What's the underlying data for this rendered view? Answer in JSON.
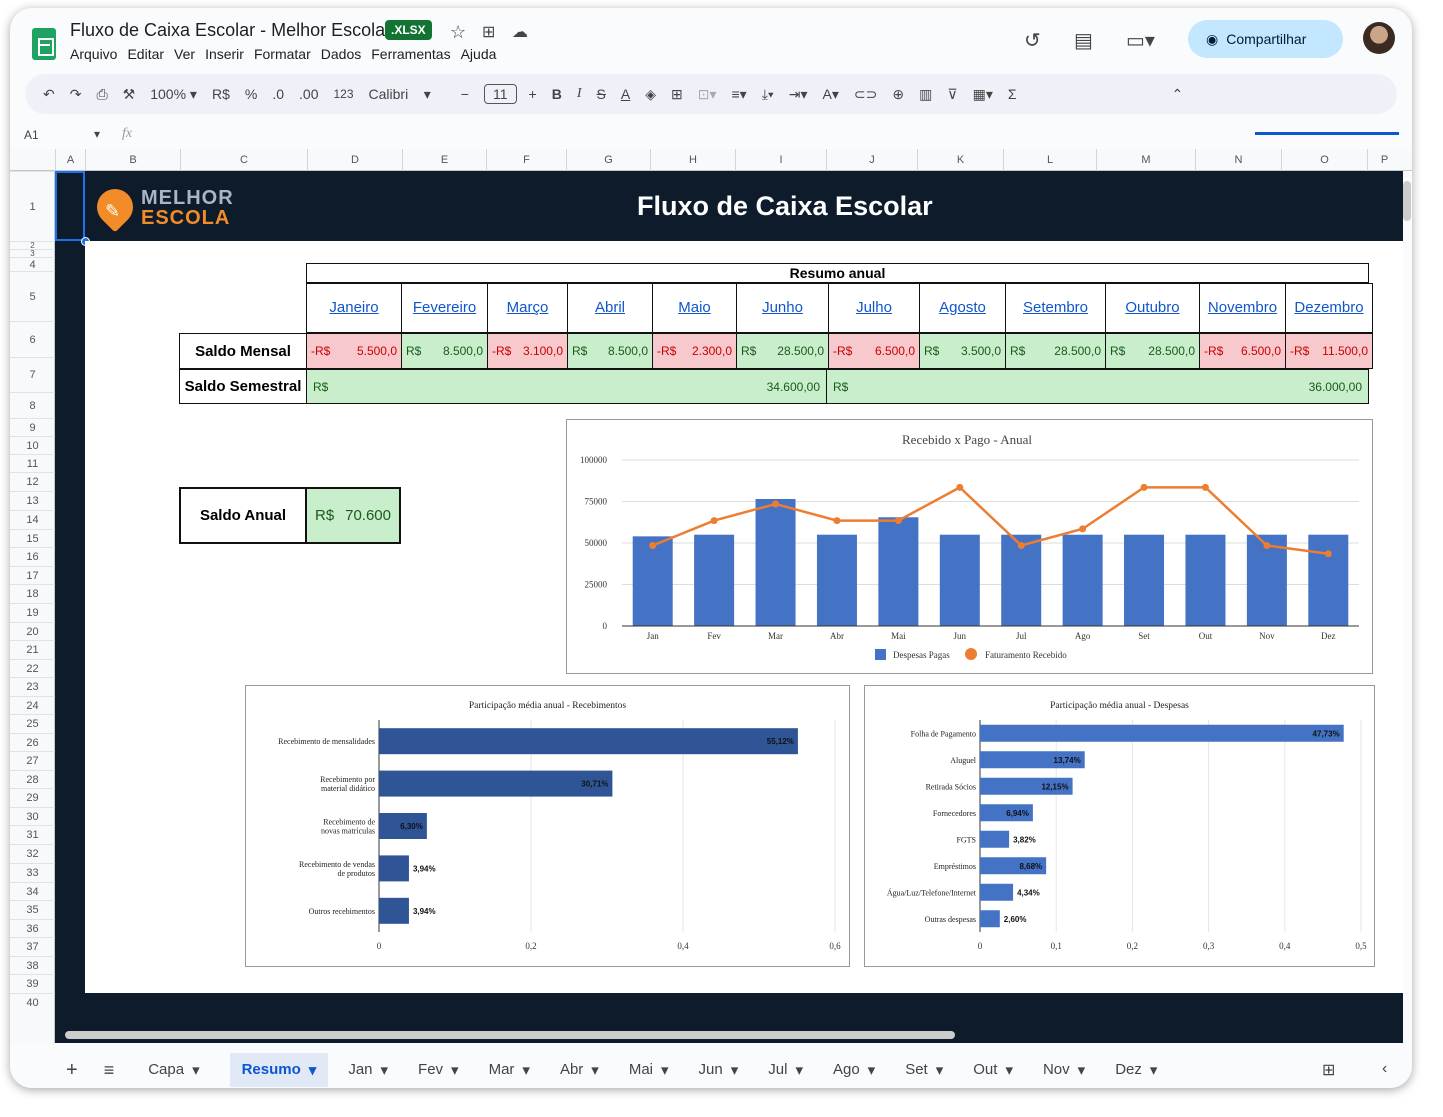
{
  "app": {
    "title": "Fluxo de Caixa Escolar - Melhor Escola",
    "badge": ".XLSX",
    "menu": [
      "Arquivo",
      "Editar",
      "Ver",
      "Inserir",
      "Formatar",
      "Dados",
      "Ferramentas",
      "Ajuda"
    ],
    "share_label": "Compartilhar"
  },
  "toolbar": {
    "zoom": "100%",
    "currency": "R$",
    "percent": "%",
    "dec_less": ".0",
    "dec_more": ".00",
    "format123": "123",
    "font": "Calibri",
    "font_size": "11"
  },
  "formula_bar": {
    "cell_ref": "A1",
    "fx": "fx"
  },
  "columns": [
    "A",
    "B",
    "C",
    "D",
    "E",
    "F",
    "G",
    "H",
    "I",
    "J",
    "K",
    "L",
    "M",
    "N",
    "O",
    "P"
  ],
  "rows": [
    "1",
    "2",
    "3",
    "4",
    "5",
    "6",
    "7",
    "8",
    "9",
    "10",
    "11",
    "12",
    "13",
    "14",
    "15",
    "16",
    "17",
    "18",
    "19",
    "20",
    "21",
    "22",
    "23",
    "24",
    "25",
    "26",
    "27",
    "28",
    "29",
    "30",
    "31",
    "32",
    "33",
    "34",
    "35",
    "36",
    "37",
    "38",
    "39",
    "40"
  ],
  "banner": {
    "brand_line1": "MELHOR",
    "brand_line2": "ESCOLA",
    "title": "Fluxo de Caixa Escolar"
  },
  "summary": {
    "header": "Resumo anual",
    "months": [
      "Janeiro",
      "Fevereiro",
      "Março",
      "Abril",
      "Maio",
      "Junho",
      "Julho",
      "Agosto",
      "Setembro",
      "Outubro",
      "Novembro",
      "Dezembro"
    ],
    "saldo_mensal_label": "Saldo Mensal",
    "saldo_mensal": [
      {
        "prefix": "-R$",
        "value": "5.500,0",
        "neg": true
      },
      {
        "prefix": "R$",
        "value": "8.500,0",
        "neg": false
      },
      {
        "prefix": "-R$",
        "value": "3.100,0",
        "neg": true
      },
      {
        "prefix": "R$",
        "value": "8.500,0",
        "neg": false
      },
      {
        "prefix": "-R$",
        "value": "2.300,0",
        "neg": true
      },
      {
        "prefix": "R$",
        "value": "28.500,0",
        "neg": false
      },
      {
        "prefix": "-R$",
        "value": "6.500,0",
        "neg": true
      },
      {
        "prefix": "R$",
        "value": "3.500,0",
        "neg": false
      },
      {
        "prefix": "R$",
        "value": "28.500,0",
        "neg": false
      },
      {
        "prefix": "R$",
        "value": "28.500,0",
        "neg": false
      },
      {
        "prefix": "-R$",
        "value": "6.500,0",
        "neg": true
      },
      {
        "prefix": "-R$",
        "value": "11.500,0",
        "neg": true
      }
    ],
    "saldo_semestral_label": "Saldo Semestral",
    "semestral": [
      {
        "prefix": "R$",
        "value": "34.600,00"
      },
      {
        "prefix": "R$",
        "value": "36.000,00"
      }
    ],
    "saldo_anual_label": "Saldo Anual",
    "saldo_anual_prefix": "R$",
    "saldo_anual_value": "70.600"
  },
  "chart_data": [
    {
      "type": "bar",
      "title": "Recebido x Pago - Anual",
      "categories": [
        "Jan",
        "Fev",
        "Mar",
        "Abr",
        "Mai",
        "Jun",
        "Jul",
        "Ago",
        "Set",
        "Out",
        "Nov",
        "Dez"
      ],
      "series": [
        {
          "name": "Despesas Pagas",
          "type": "bar",
          "color": "#4472c4",
          "values": [
            54000,
            55000,
            76500,
            55000,
            65500,
            55000,
            55000,
            55000,
            55000,
            55000,
            55000,
            55000
          ]
        },
        {
          "name": "Faturamento Recebido",
          "type": "line",
          "color": "#ed7d31",
          "values": [
            48500,
            63500,
            73500,
            63500,
            63500,
            83500,
            48500,
            58500,
            83500,
            83500,
            48500,
            43500
          ]
        }
      ],
      "yticks": [
        "0",
        "25000",
        "50000",
        "75000",
        "100000"
      ],
      "ylim": [
        0,
        100000
      ],
      "legend": "bottom"
    },
    {
      "type": "bar",
      "orientation": "horizontal",
      "title": "Participação média anual - Recebimentos",
      "categories": [
        "Recebimento de mensalidades",
        "Recebimento por material didático",
        "Recebimento de novas matrículas",
        "Recebimento de vendas de produtos",
        "Outros recebimentos"
      ],
      "values": [
        0.5512,
        0.3071,
        0.063,
        0.0394,
        0.0394
      ],
      "labels": [
        "55,12%",
        "30,71%",
        "6,30%",
        "3,94%",
        "3,94%"
      ],
      "xticks": [
        "0",
        "0,2",
        "0,4",
        "0,6"
      ],
      "xlim": [
        0,
        0.6
      ],
      "color": "#2f5597"
    },
    {
      "type": "bar",
      "orientation": "horizontal",
      "title": "Participação média anual - Despesas",
      "categories": [
        "Folha de Pagamento",
        "Aluguel",
        "Retirada Sócios",
        "Fornecedores",
        "FGTS",
        "Empréstimos",
        "Água/Luz/Telefone/Internet",
        "Outras despesas"
      ],
      "values": [
        0.4773,
        0.1374,
        0.1215,
        0.0694,
        0.0382,
        0.0868,
        0.0434,
        0.026
      ],
      "labels": [
        "47,73%",
        "13,74%",
        "12,15%",
        "6,94%",
        "3,82%",
        "8,68%",
        "4,34%",
        "2,60%"
      ],
      "xticks": [
        "0",
        "0,1",
        "0,2",
        "0,3",
        "0,4",
        "0,5"
      ],
      "xlim": [
        0,
        0.5
      ],
      "color": "#4472c4"
    }
  ],
  "sheet_tabs": [
    "Capa",
    "Resumo",
    "Jan",
    "Fev",
    "Mar",
    "Abr",
    "Mai",
    "Jun",
    "Jul",
    "Ago",
    "Set",
    "Out",
    "Nov",
    "Dez"
  ],
  "active_tab": "Resumo"
}
